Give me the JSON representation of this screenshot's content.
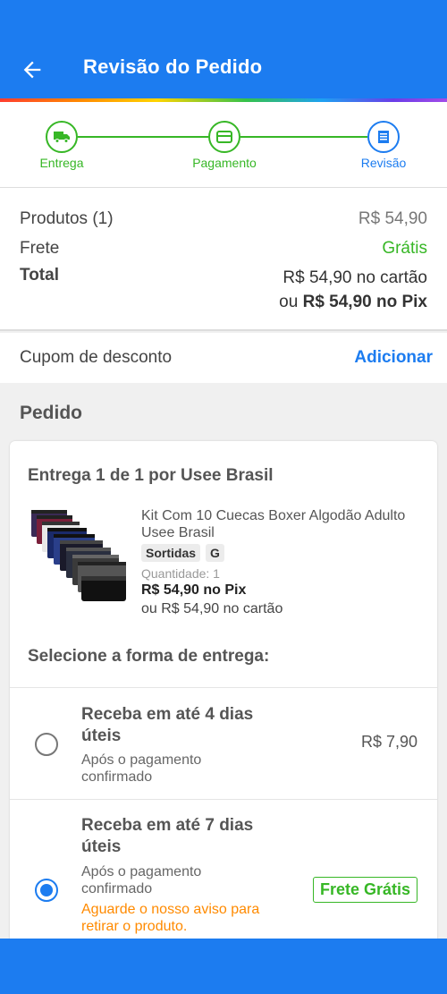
{
  "header": {
    "title": "Revisão do Pedido",
    "back_icon": "arrow-left-icon"
  },
  "steps": [
    {
      "label": "Entrega",
      "icon": "truck-icon",
      "status": "done"
    },
    {
      "label": "Pagamento",
      "icon": "card-icon",
      "status": "done"
    },
    {
      "label": "Revisão",
      "icon": "receipt-icon",
      "status": "current"
    }
  ],
  "summary": {
    "products_label": "Produtos (1)",
    "products_value": "R$ 54,90",
    "shipping_label": "Frete",
    "shipping_value": "Grátis",
    "total_label": "Total",
    "total_card": "R$ 54,90 no cartão",
    "total_pix_prefix": "ou ",
    "total_pix": "R$ 54,90 no Pix"
  },
  "coupon": {
    "label": "Cupom de desconto",
    "action": "Adicionar"
  },
  "order": {
    "section_title": "Pedido",
    "seller": "Entrega 1 de 1 por Usee Brasil",
    "product": {
      "name": "Kit Com 10 Cuecas Boxer Algodão Adulto Usee Brasil",
      "tags": [
        "Sortidas",
        "G"
      ],
      "quantity": "Quantidade:  1",
      "pix_price": "R$ 54,90 no Pix",
      "card_price": "ou R$ 54,90 no cartão"
    },
    "shipping_title": "Selecione a forma de entrega:",
    "options": [
      {
        "title": "Receba em até 4 dias úteis",
        "subtitle": "Após o pagamento confirmado",
        "price": "R$ 7,90",
        "selected": false
      },
      {
        "title": "Receba em até 7 dias úteis",
        "subtitle": "Após o pagamento confirmado",
        "warning": "Aguarde o nosso aviso para retirar o produto.",
        "badge": "Frete Grátis",
        "selected": true
      }
    ]
  },
  "colors": {
    "primary": "#1c7cf0",
    "success": "#37b726",
    "warning": "#ff8a00"
  }
}
